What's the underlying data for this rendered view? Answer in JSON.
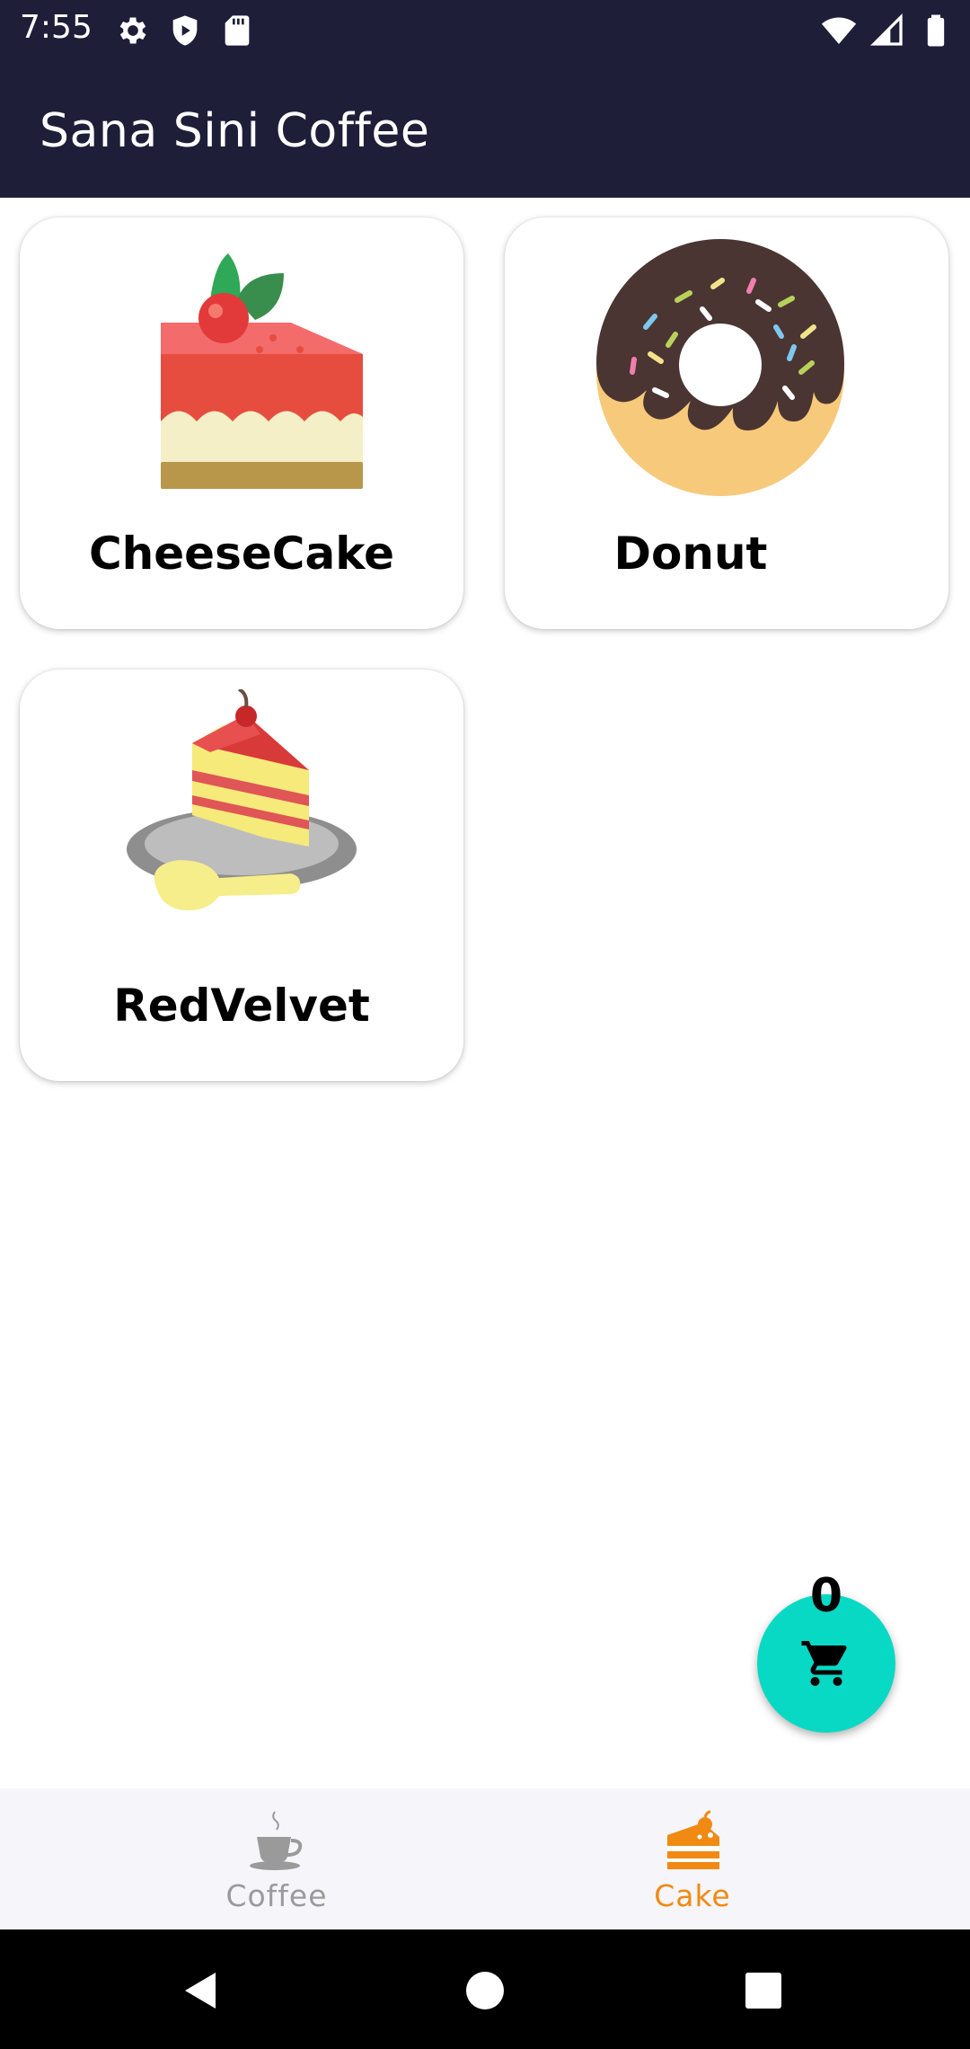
{
  "status_bar": {
    "time": "7:55",
    "left_icons": [
      "settings-icon",
      "shield-icon",
      "sd-card-icon"
    ],
    "right_icons": [
      "wifi-icon",
      "signal-icon",
      "battery-icon"
    ]
  },
  "app_bar": {
    "title": "Sana Sini Coffee"
  },
  "products": [
    {
      "name": "CheeseCake",
      "icon": "cheesecake-image"
    },
    {
      "name": "Donut",
      "icon": "donut-image"
    },
    {
      "name": "RedVelvet",
      "icon": "redvelvet-image"
    }
  ],
  "cart": {
    "count": "0",
    "icon": "cart-icon",
    "color": "#08d9c4"
  },
  "bottom_nav": {
    "items": [
      {
        "label": "Coffee",
        "icon": "coffee-cup-icon",
        "active": false
      },
      {
        "label": "Cake",
        "icon": "cake-icon",
        "active": true
      }
    ],
    "active_color": "#f08a12",
    "inactive_color": "#9a9a9a"
  },
  "system_nav": {
    "buttons": [
      "back-icon",
      "home-icon",
      "recents-icon"
    ]
  },
  "colors": {
    "app_bar": "#1f1e39",
    "background": "#ffffff"
  }
}
